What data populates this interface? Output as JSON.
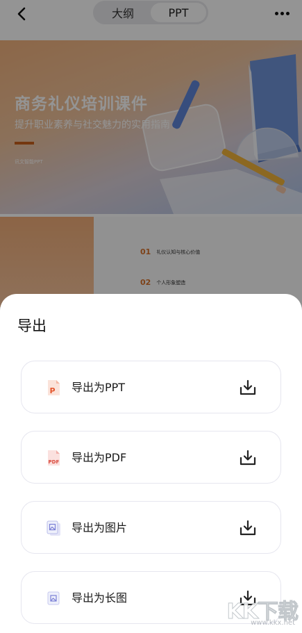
{
  "header": {
    "tabs": [
      {
        "label": "大纲",
        "active": false
      },
      {
        "label": "PPT",
        "active": true
      }
    ]
  },
  "slide1": {
    "title": "商务礼仪培训课件",
    "subtitle": "提升职业素养与社交魅力的实用指南",
    "note": "讯文智能PPT"
  },
  "slide2": {
    "items": [
      {
        "num": "01",
        "text": "礼仪认知与核心价值"
      },
      {
        "num": "02",
        "text": "个人形象塑造"
      }
    ]
  },
  "export_sheet": {
    "title": "导出",
    "options": [
      {
        "label": "导出为PPT",
        "icon": "ppt-file-icon"
      },
      {
        "label": "导出为PDF",
        "icon": "pdf-file-icon"
      },
      {
        "label": "导出为图片",
        "icon": "image-stack-icon"
      },
      {
        "label": "导出为长图",
        "icon": "long-image-icon"
      }
    ]
  },
  "watermark": {
    "brand": "KK下载",
    "url": "www.kkx.net"
  },
  "colors": {
    "accent_orange": "#d8732c",
    "ppt_icon": "#e4572e",
    "pdf_icon": "#d9483b",
    "image_icon": "#7b7fd6"
  }
}
